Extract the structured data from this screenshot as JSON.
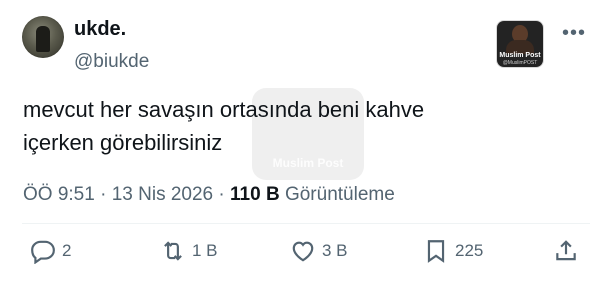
{
  "author": {
    "display_name": "ukde.",
    "handle": "@biukde"
  },
  "badge": {
    "title": "Muslim Post",
    "subtitle": "@MuslimPOST"
  },
  "tweet": {
    "lines": [
      "mevcut her savaşın ortasında beni kahve",
      "içerken görebilirsiniz"
    ]
  },
  "watermark": {
    "text": "Muslim Post"
  },
  "meta": {
    "time": "ÖÖ 9:51",
    "sep1": " · ",
    "date": "13 Nis 2026",
    "sep2": " · ",
    "views": "110 B",
    "views_label": " Görüntüleme"
  },
  "actions": {
    "reply_count": "2",
    "retweet_count": "1 B",
    "like_count": "3 B",
    "bookmark_count": "225"
  },
  "icons": {
    "more": "more-icon",
    "reply": "reply-icon",
    "retweet": "retweet-icon",
    "like": "heart-icon",
    "bookmark": "bookmark-icon",
    "share": "share-icon"
  }
}
